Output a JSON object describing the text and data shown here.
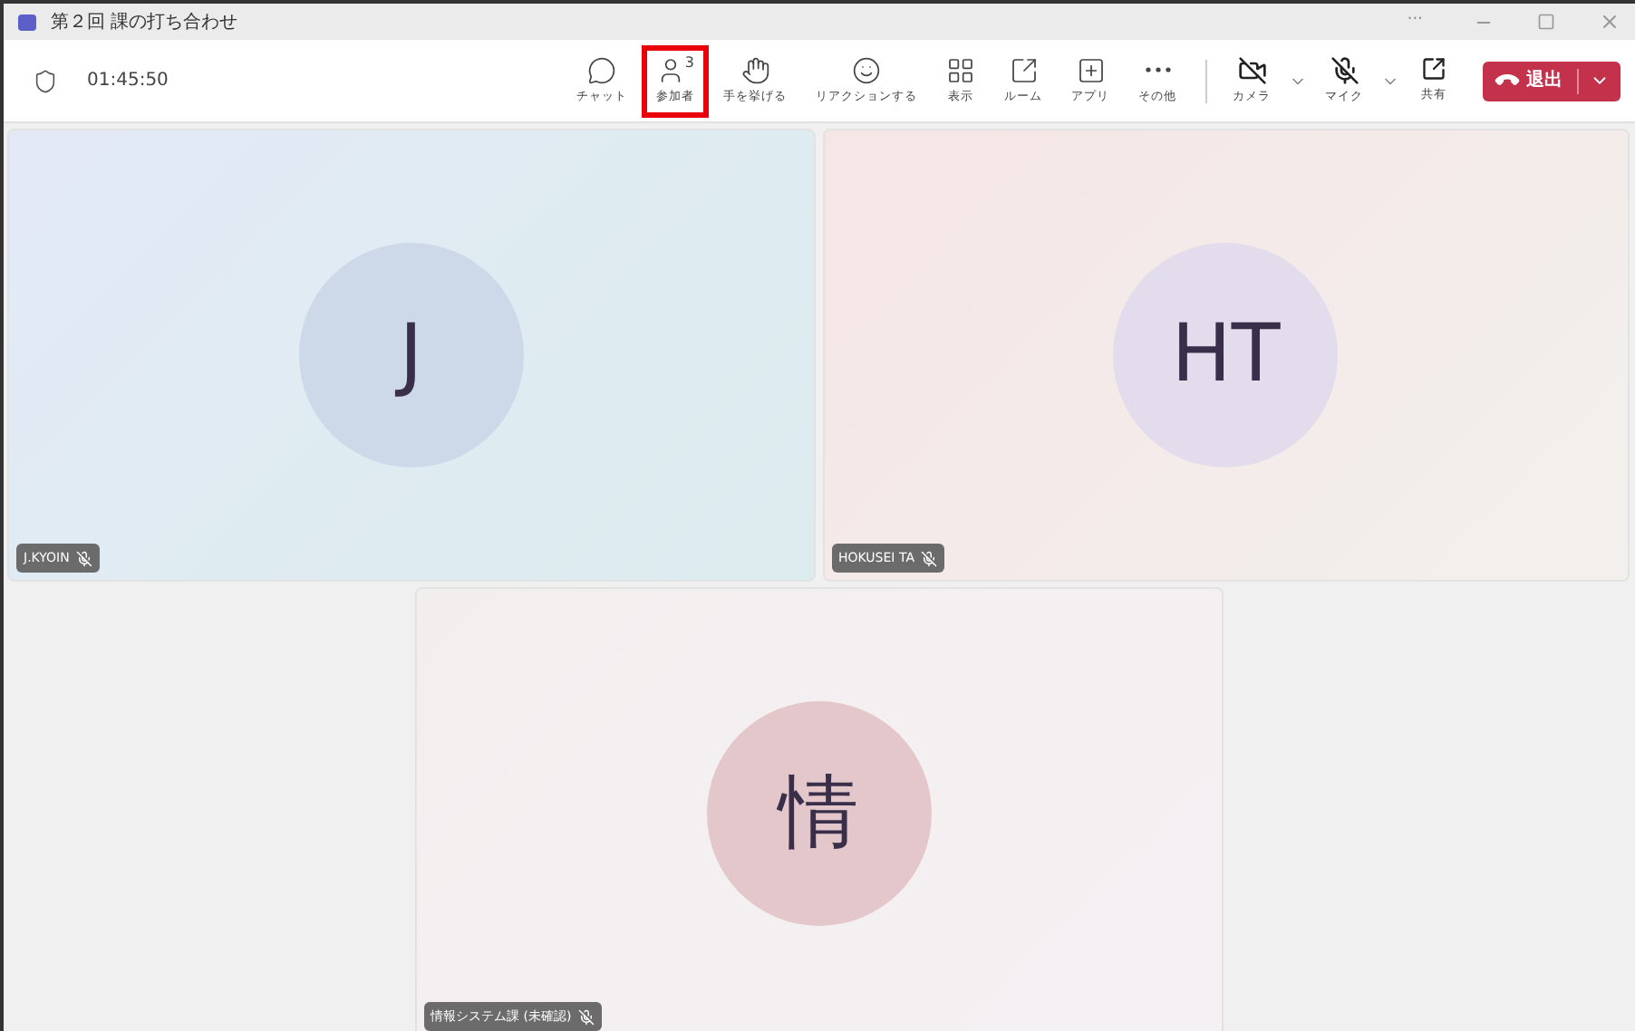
{
  "window": {
    "title": "第２回 課の打ち合わせ",
    "controls": [
      "···"
    ]
  },
  "toolbar": {
    "timer": "01:45:50",
    "items": [
      {
        "kind": "chat",
        "label": "チャット",
        "highlighted": false
      },
      {
        "kind": "people",
        "label": "参加者",
        "count": "3",
        "highlighted": true
      },
      {
        "kind": "hand",
        "label": "手を挙げる",
        "highlighted": false
      },
      {
        "kind": "react",
        "label": "リアクションする",
        "highlighted": false
      },
      {
        "kind": "view",
        "label": "表示",
        "highlighted": false
      },
      {
        "kind": "room",
        "label": "ルーム",
        "highlighted": false
      },
      {
        "kind": "apps",
        "label": "アプリ",
        "highlighted": false
      },
      {
        "kind": "more",
        "label": "その他",
        "highlighted": false
      }
    ],
    "devices": [
      {
        "kind": "camera",
        "label": "カメラ",
        "on": false
      },
      {
        "kind": "mic",
        "label": "マイク",
        "on": false
      }
    ],
    "share": {
      "label": "共有"
    },
    "leave": {
      "label": "退出"
    }
  },
  "tiles": [
    {
      "initials": "J",
      "name": "J.KYOIN",
      "muted": true,
      "color": "#cdd9e8"
    },
    {
      "initials": "HT",
      "name": "HOKUSEI TA",
      "muted": true,
      "color": "#e2dcec"
    },
    {
      "initials": "情",
      "name": "情報システム課 (未確認)",
      "muted": true,
      "color": "#e4c7cb"
    }
  ]
}
